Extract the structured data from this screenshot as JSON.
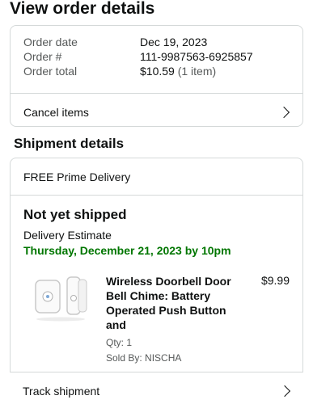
{
  "page": {
    "title": "View order details"
  },
  "order": {
    "rows": [
      {
        "label": "Order date",
        "value": "Dec 19, 2023"
      },
      {
        "label": "Order #",
        "value": "111-9987563-6925857"
      },
      {
        "label": "Order total",
        "value": "$10.59",
        "extra": "(1 item)"
      }
    ],
    "cancel_label": "Cancel items"
  },
  "shipment": {
    "section_title": "Shipment details",
    "method": "FREE Prime Delivery",
    "status": "Not yet shipped",
    "estimate_label": "Delivery Estimate",
    "estimate_date": "Thursday, December 21, 2023 by 10pm",
    "item": {
      "title": "Wireless Doorbell Door Bell Chime: Battery Operated Push Button and",
      "price": "$9.99",
      "qty": "Qty: 1",
      "seller": "Sold By: NISCHA"
    },
    "track_label": "Track shipment"
  },
  "colors": {
    "green": "#007600",
    "border": "#d5d9d9",
    "muted": "#565959"
  }
}
